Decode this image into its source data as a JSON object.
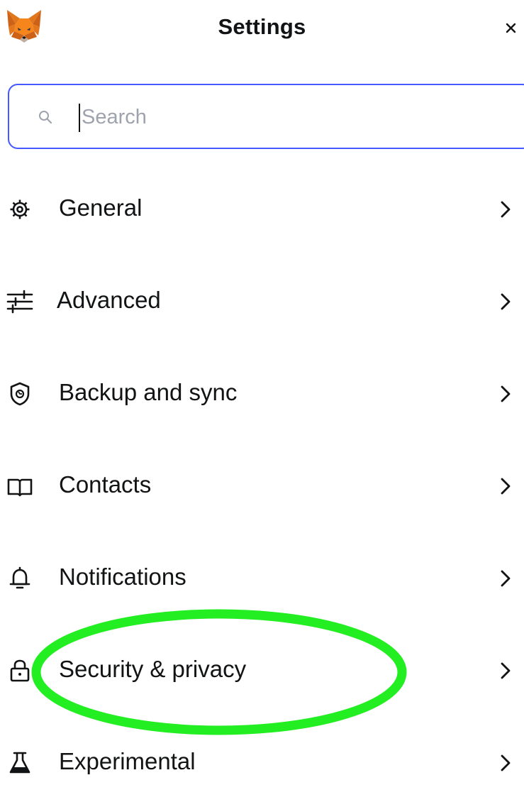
{
  "header": {
    "title": "Settings",
    "logo_icon": "metamask-fox-icon",
    "close_icon": "close-icon"
  },
  "search": {
    "placeholder": "Search",
    "value": "",
    "icon": "search-icon",
    "border_color": "#4459ff"
  },
  "menu": {
    "items": [
      {
        "label": "General",
        "icon": "gear-icon"
      },
      {
        "label": "Advanced",
        "icon": "sliders-icon"
      },
      {
        "label": "Backup and sync",
        "icon": "shield-icon"
      },
      {
        "label": "Contacts",
        "icon": "book-icon"
      },
      {
        "label": "Notifications",
        "icon": "bell-icon"
      },
      {
        "label": "Security & privacy",
        "icon": "lock-icon"
      },
      {
        "label": "Experimental",
        "icon": "flask-icon"
      }
    ]
  },
  "annotation": {
    "highlight_color": "#22ee22",
    "highlighted_item": "Security & privacy"
  }
}
